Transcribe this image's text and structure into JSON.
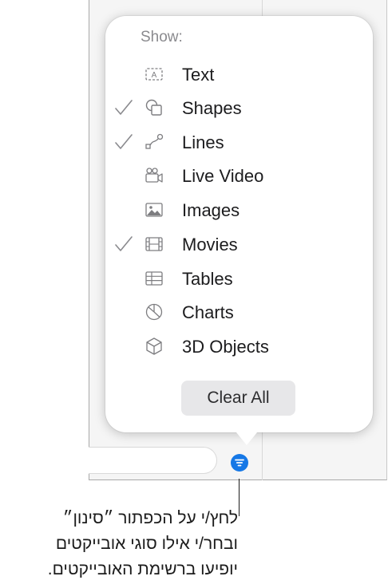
{
  "popover": {
    "header": "Show:",
    "items": [
      {
        "label": "Text",
        "icon": "text-box-icon",
        "checked": false
      },
      {
        "label": "Shapes",
        "icon": "shapes-icon",
        "checked": true
      },
      {
        "label": "Lines",
        "icon": "lines-icon",
        "checked": true
      },
      {
        "label": "Live Video",
        "icon": "live-video-icon",
        "checked": false
      },
      {
        "label": "Images",
        "icon": "image-icon",
        "checked": false
      },
      {
        "label": "Movies",
        "icon": "film-icon",
        "checked": true
      },
      {
        "label": "Tables",
        "icon": "table-icon",
        "checked": false
      },
      {
        "label": "Charts",
        "icon": "pie-chart-icon",
        "checked": false
      },
      {
        "label": "3D Objects",
        "icon": "cube-icon",
        "checked": false
      }
    ],
    "clear_button": "Clear All"
  },
  "toolbar": {
    "filter_icon": "filter-icon",
    "filter_color": "#1678e6"
  },
  "caption": {
    "line1": "לחץ/י על הכפתור ״סינון״",
    "line2": "ובחר/י אילו סוגי אובייקטים",
    "line3": "יופיעו ברשימת האובייקטים."
  }
}
